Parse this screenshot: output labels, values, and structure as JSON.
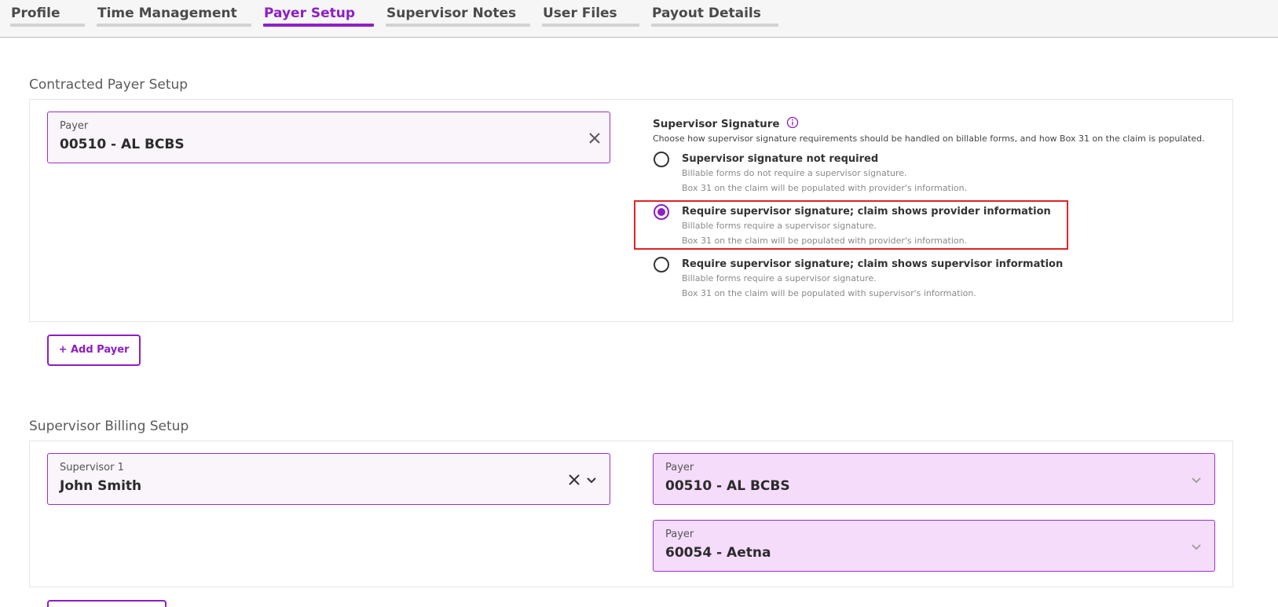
{
  "tabs": [
    {
      "label": "Profile"
    },
    {
      "label": "Time Management"
    },
    {
      "label": "Payer Setup"
    },
    {
      "label": "Supervisor Notes"
    },
    {
      "label": "User Files"
    },
    {
      "label": "Payout Details"
    }
  ],
  "active_tab": "Payer Setup",
  "contracted": {
    "title": "Contracted Payer Setup",
    "payer_label": "Payer",
    "payer_value": "00510 - AL BCBS",
    "signature": {
      "title": "Supervisor Signature",
      "description": "Choose how supervisor signature requirements should be handled on billable forms, and how Box 31 on the claim is populated.",
      "options": [
        {
          "title": "Supervisor signature not required",
          "line1": "Billable forms do not require a supervisor signature.",
          "line2": "Box 31 on the claim will be populated with provider's information.",
          "selected": false
        },
        {
          "title": "Require supervisor signature; claim shows provider information",
          "line1": "Billable forms require a supervisor signature.",
          "line2": "Box 31 on the claim will be populated with provider's information.",
          "selected": true
        },
        {
          "title": "Require supervisor signature; claim shows supervisor information",
          "line1": "Billable forms require a supervisor signature.",
          "line2": "Box 31 on the claim will be populated with supervisor's information.",
          "selected": false
        }
      ]
    },
    "add_payer_label": "+ Add Payer"
  },
  "billing": {
    "title": "Supervisor Billing Setup",
    "supervisor_label": "Supervisor 1",
    "supervisor_value": "John Smith",
    "payers": [
      {
        "label": "Payer",
        "value": "00510 - AL BCBS"
      },
      {
        "label": "Payer",
        "value": "60054 - Aetna"
      }
    ]
  },
  "colors": {
    "accent": "#8e1fc2",
    "highlight": "#e02424",
    "filled_field": "#f5dcfb"
  },
  "icons": [
    "close-icon",
    "chevron-down-icon",
    "info-icon"
  ]
}
